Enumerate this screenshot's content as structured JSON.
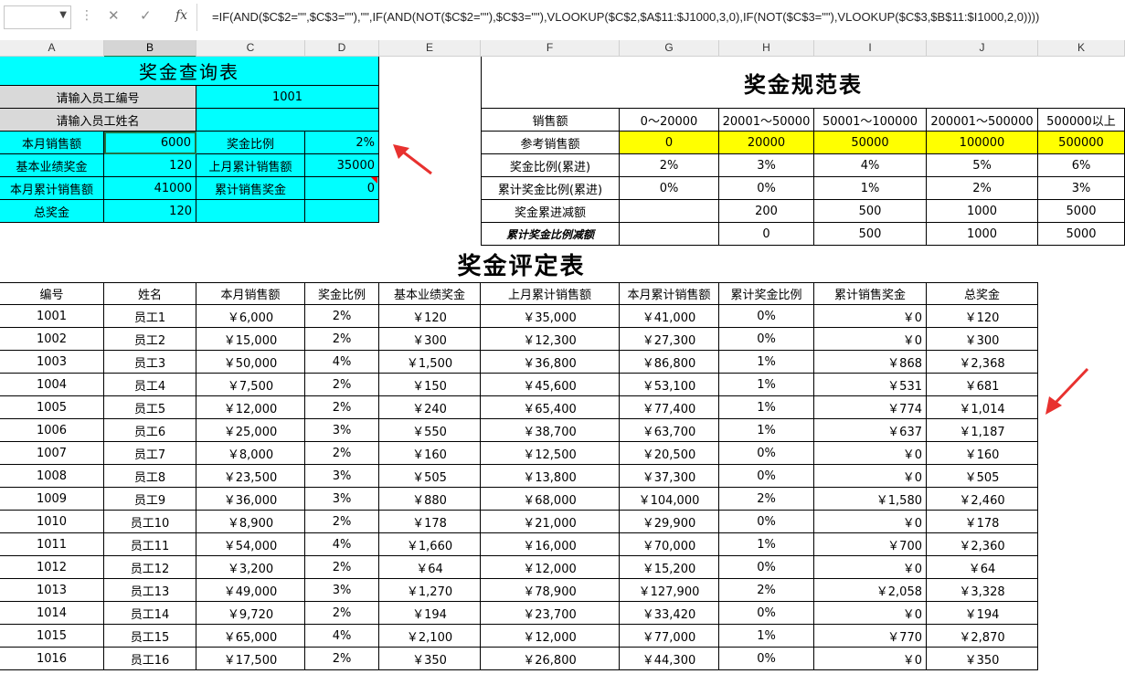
{
  "formula_bar": {
    "name_box": "",
    "formula": "=IF(AND($C$2=\"\",$C$3=\"\"),\"\",IF(AND(NOT($C$2=\"\"),$C$3=\"\"),VLOOKUP($C$2,$A$11:$J1000,3,0),IF(NOT($C$3=\"\"),VLOOKUP($C$3,$B$11:$I1000,2,0))))"
  },
  "columns": [
    "A",
    "B",
    "C",
    "D",
    "E",
    "F",
    "G",
    "H",
    "I",
    "J",
    "K"
  ],
  "query": {
    "title": "奖金查询表",
    "id_label": "请输入员工编号",
    "id_value": "1001",
    "name_label": "请输入员工姓名",
    "name_value": "",
    "sales_label": "本月销售额",
    "sales_value": "6000",
    "ratio_label": "奖金比例",
    "ratio_value": "2%",
    "basic_label": "基本业绩奖金",
    "basic_value": "120",
    "prev_label": "上月累计销售额",
    "prev_value": "35000",
    "cum_label": "本月累计销售额",
    "cum_value": "41000",
    "cumbonus_label": "累计销售奖金",
    "cumbonus_value": "0",
    "total_label": "总奖金",
    "total_value": "120"
  },
  "norms": {
    "title": "奖金规范表",
    "rows": [
      [
        "销售额",
        "0～20000",
        "20001～50000",
        "50001～100000",
        "200001～500000",
        "500000以上"
      ],
      [
        "参考销售额",
        "0",
        "20000",
        "50000",
        "100000",
        "500000"
      ],
      [
        "奖金比例(累进)",
        "2%",
        "3%",
        "4%",
        "5%",
        "6%"
      ],
      [
        "累计奖金比例(累进)",
        "0%",
        "0%",
        "1%",
        "2%",
        "3%"
      ],
      [
        "奖金累进减额",
        "",
        "200",
        "500",
        "1000",
        "5000"
      ],
      [
        "累计奖金比例减额",
        "",
        "0",
        "500",
        "1000",
        "5000"
      ]
    ]
  },
  "eval": {
    "title": "奖金评定表",
    "headers": [
      "编号",
      "姓名",
      "本月销售额",
      "奖金比例",
      "基本业绩奖金",
      "上月累计销售额",
      "本月累计销售额",
      "累计奖金比例",
      "累计销售奖金",
      "总奖金"
    ],
    "rows": [
      [
        "1001",
        "员工1",
        "￥6,000",
        "2%",
        "￥120",
        "￥35,000",
        "￥41,000",
        "0%",
        "￥0",
        "￥120"
      ],
      [
        "1002",
        "员工2",
        "￥15,000",
        "2%",
        "￥300",
        "￥12,300",
        "￥27,300",
        "0%",
        "￥0",
        "￥300"
      ],
      [
        "1003",
        "员工3",
        "￥50,000",
        "4%",
        "￥1,500",
        "￥36,800",
        "￥86,800",
        "1%",
        "￥868",
        "￥2,368"
      ],
      [
        "1004",
        "员工4",
        "￥7,500",
        "2%",
        "￥150",
        "￥45,600",
        "￥53,100",
        "1%",
        "￥531",
        "￥681"
      ],
      [
        "1005",
        "员工5",
        "￥12,000",
        "2%",
        "￥240",
        "￥65,400",
        "￥77,400",
        "1%",
        "￥774",
        "￥1,014"
      ],
      [
        "1006",
        "员工6",
        "￥25,000",
        "3%",
        "￥550",
        "￥38,700",
        "￥63,700",
        "1%",
        "￥637",
        "￥1,187"
      ],
      [
        "1007",
        "员工7",
        "￥8,000",
        "2%",
        "￥160",
        "￥12,500",
        "￥20,500",
        "0%",
        "￥0",
        "￥160"
      ],
      [
        "1008",
        "员工8",
        "￥23,500",
        "3%",
        "￥505",
        "￥13,800",
        "￥37,300",
        "0%",
        "￥0",
        "￥505"
      ],
      [
        "1009",
        "员工9",
        "￥36,000",
        "3%",
        "￥880",
        "￥68,000",
        "￥104,000",
        "2%",
        "￥1,580",
        "￥2,460"
      ],
      [
        "1010",
        "员工10",
        "￥8,900",
        "2%",
        "￥178",
        "￥21,000",
        "￥29,900",
        "0%",
        "￥0",
        "￥178"
      ],
      [
        "1011",
        "员工11",
        "￥54,000",
        "4%",
        "￥1,660",
        "￥16,000",
        "￥70,000",
        "1%",
        "￥700",
        "￥2,360"
      ],
      [
        "1012",
        "员工12",
        "￥3,200",
        "2%",
        "￥64",
        "￥12,000",
        "￥15,200",
        "0%",
        "￥0",
        "￥64"
      ],
      [
        "1013",
        "员工13",
        "￥49,000",
        "3%",
        "￥1,270",
        "￥78,900",
        "￥127,900",
        "2%",
        "￥2,058",
        "￥3,328"
      ],
      [
        "1014",
        "员工14",
        "￥9,720",
        "2%",
        "￥194",
        "￥23,700",
        "￥33,420",
        "0%",
        "￥0",
        "￥194"
      ],
      [
        "1015",
        "员工15",
        "￥65,000",
        "4%",
        "￥2,100",
        "￥12,000",
        "￥77,000",
        "1%",
        "￥770",
        "￥2,870"
      ],
      [
        "1016",
        "员工16",
        "￥17,500",
        "2%",
        "￥350",
        "￥26,800",
        "￥44,300",
        "0%",
        "￥0",
        "￥350"
      ]
    ]
  },
  "colors": {
    "cyan": "#00ffff",
    "yellow": "#ffff00",
    "gray": "#d9d9d9",
    "arrow": "#e8312f"
  }
}
